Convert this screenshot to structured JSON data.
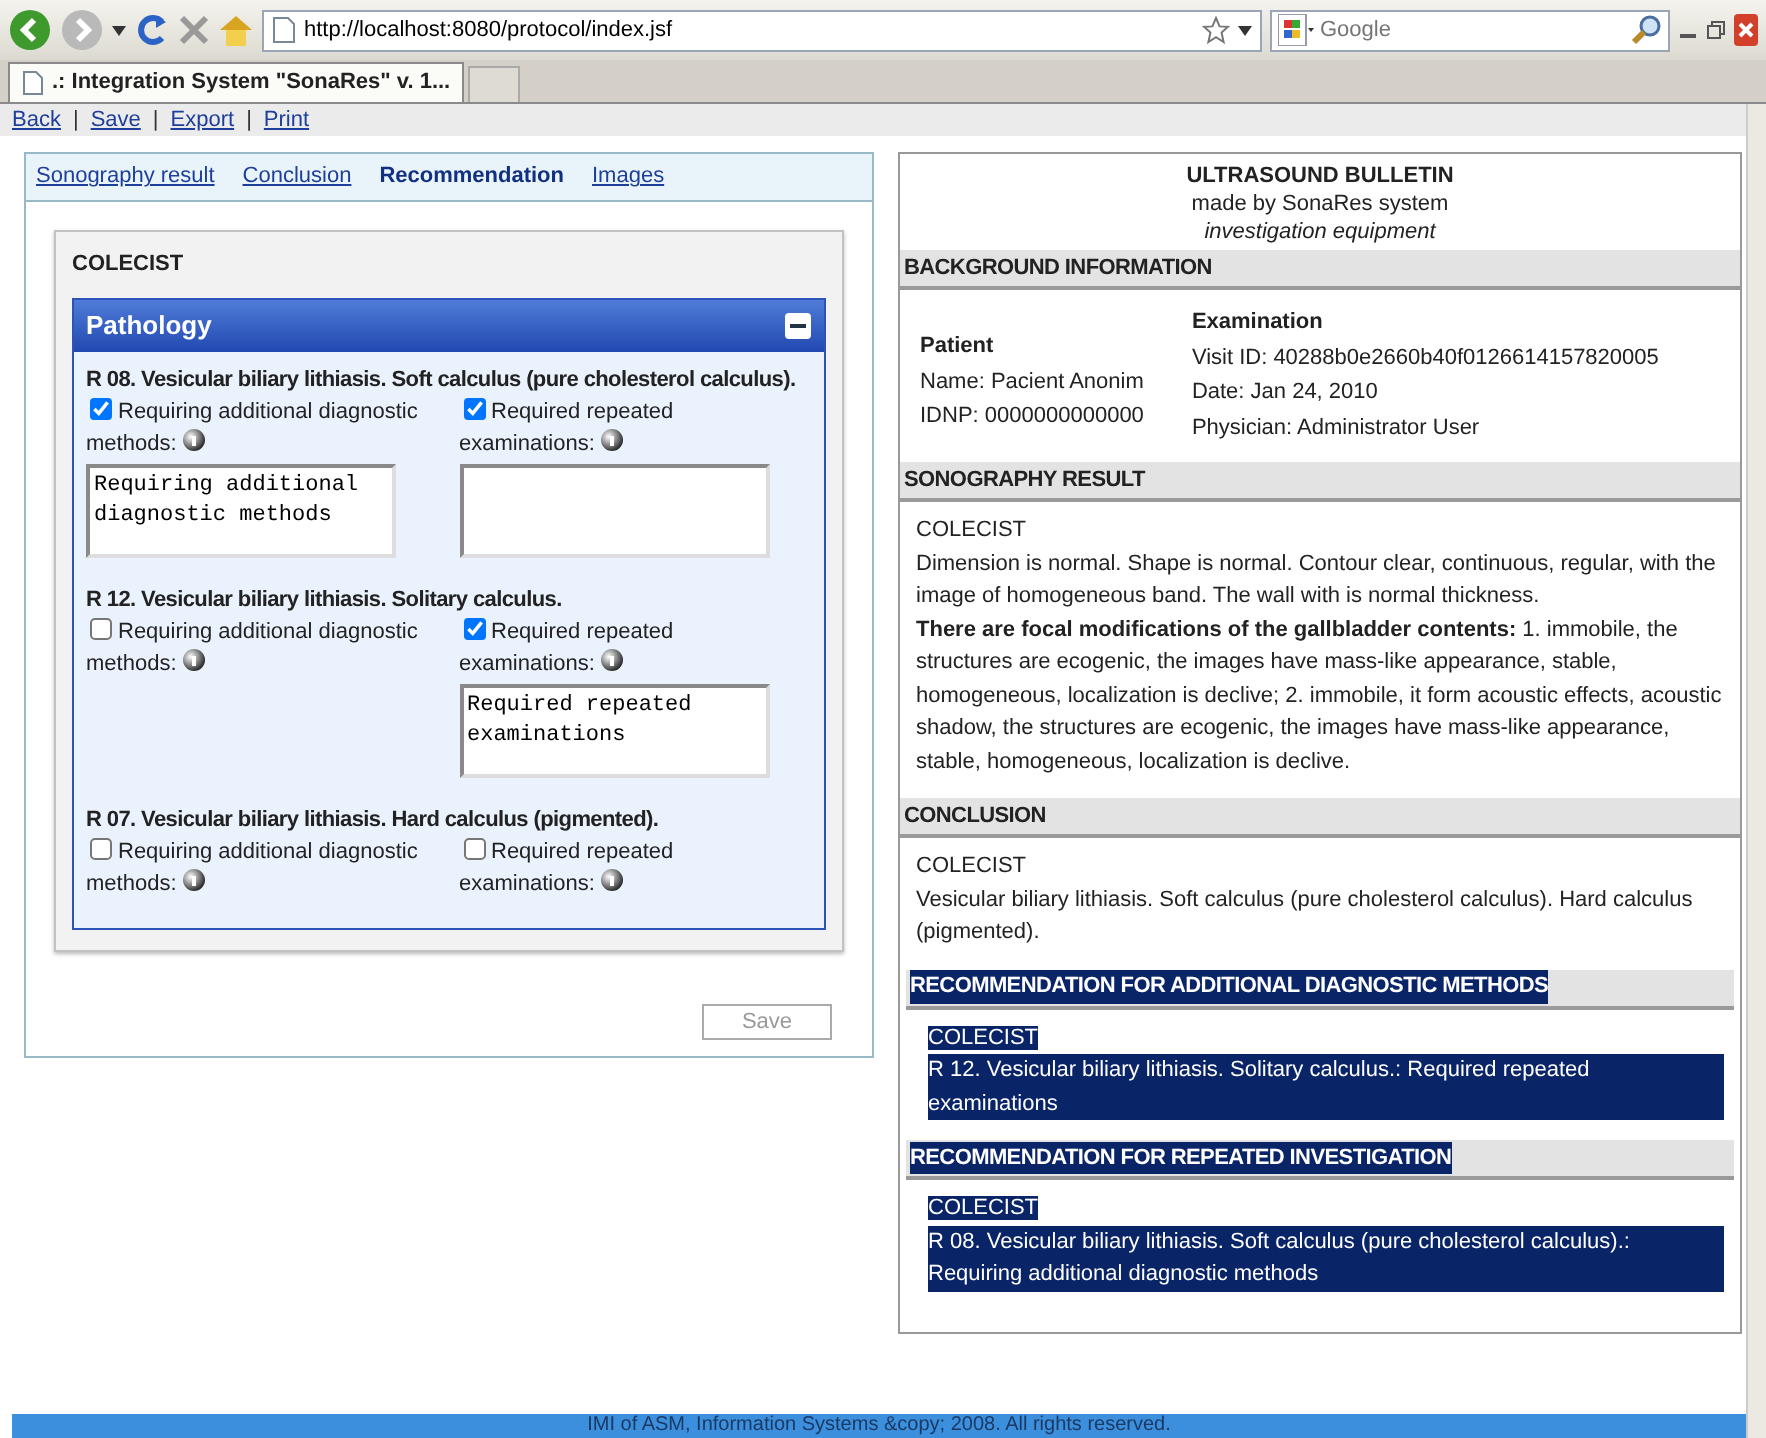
{
  "browser": {
    "url": "http://localhost:8080/protocol/index.jsf",
    "search_placeholder": "Google",
    "tabs": [
      {
        "label": ".: Integration System \"SonaRes\" v. 1...",
        "selected": true
      }
    ]
  },
  "page_links": [
    "Back",
    "Save",
    "Export",
    "Print"
  ],
  "page_link_separator": "|",
  "tabs": [
    {
      "label": "Sonography result",
      "selected": false
    },
    {
      "label": "Conclusion",
      "selected": false
    },
    {
      "label": "Recommendation",
      "selected": true
    },
    {
      "label": "Images",
      "selected": false
    }
  ],
  "form": {
    "group": "COLECIST",
    "panel_title": "Pathology",
    "expanded": true,
    "items": [
      {
        "title": "R 08. Vesicular biliary lithiasis. Soft calculus (pure cholesterol calculus).",
        "additional": {
          "label": "Requiring additional diagnostic methods:",
          "checked": true,
          "value": "Requiring additional diagnostic methods"
        },
        "repeated": {
          "label": "Required repeated examinations:",
          "checked": true
        }
      },
      {
        "title": "R 12. Vesicular biliary lithiasis. Solitary calculus.",
        "additional": {
          "label": "Requiring additional diagnostic methods:",
          "checked": false
        },
        "repeated": {
          "label": "Required repeated examinations:",
          "checked": true,
          "value": "Required repeated examinations"
        }
      },
      {
        "title": "R 07. Vesicular biliary lithiasis. Hard calculus (pigmented).",
        "additional": {
          "label": "Requiring additional diagnostic methods:",
          "checked": false
        },
        "repeated": {
          "label": "Required repeated examinations:",
          "checked": false
        }
      }
    ],
    "save": "Save"
  },
  "report": {
    "title": "ULTRASOUND BULLETIN",
    "subtitle": "made by SonaRes system",
    "note": "investigation equipment",
    "background": {
      "heading": "BACKGROUND INFORMATION",
      "patient": {
        "heading": "Patient",
        "lines": [
          "Name: Pacient Anonim",
          "IDNP: 0000000000000"
        ]
      },
      "examination": {
        "heading": "Examination",
        "lines": [
          "Visit ID: 40288b0e2660b40f0126614157820005",
          "Date: Jan 24, 2010",
          "Physician: Administrator User"
        ]
      }
    },
    "sections": [
      {
        "heading": "SONOGRAPHY RESULT",
        "highlighted": false,
        "lines": [
          "COLECIST",
          "Dimension is normal. Shape is normal. Contour clear, continuous, regular, with the image of homogeneous band. The wall with is normal thickness.",
          "**There are focal modifications of the gallbladder contents:** 1. immobile, the structures are ecogenic, the images have mass-like appearance, stable, homogeneous, localization is declive; 2. immobile, it form acoustic effects, acoustic shadow, the structures are ecogenic, the images have mass-like appearance, stable, homogeneous, localization is declive."
        ]
      },
      {
        "heading": "CONCLUSION",
        "highlighted": false,
        "lines": [
          "COLECIST",
          "Vesicular biliary lithiasis. Soft calculus (pure cholesterol calculus). Hard calculus (pigmented)."
        ]
      },
      {
        "heading": "RECOMMENDATION FOR ADDITIONAL DIAGNOSTIC METHODS",
        "highlighted": true,
        "lines": [
          "COLECIST",
          "R 12. Vesicular biliary lithiasis. Solitary calculus.: Required repeated examinations"
        ]
      },
      {
        "heading": "RECOMMENDATION FOR REPEATED INVESTIGATION",
        "highlighted": true,
        "lines": [
          "COLECIST",
          "R 08. Vesicular biliary lithiasis. Soft calculus (pure cholesterol calculus).: Requiring additional diagnostic methods"
        ]
      }
    ]
  },
  "footer": "IMI of ASM, Information Systems &copy; 2008. All rights reserved."
}
